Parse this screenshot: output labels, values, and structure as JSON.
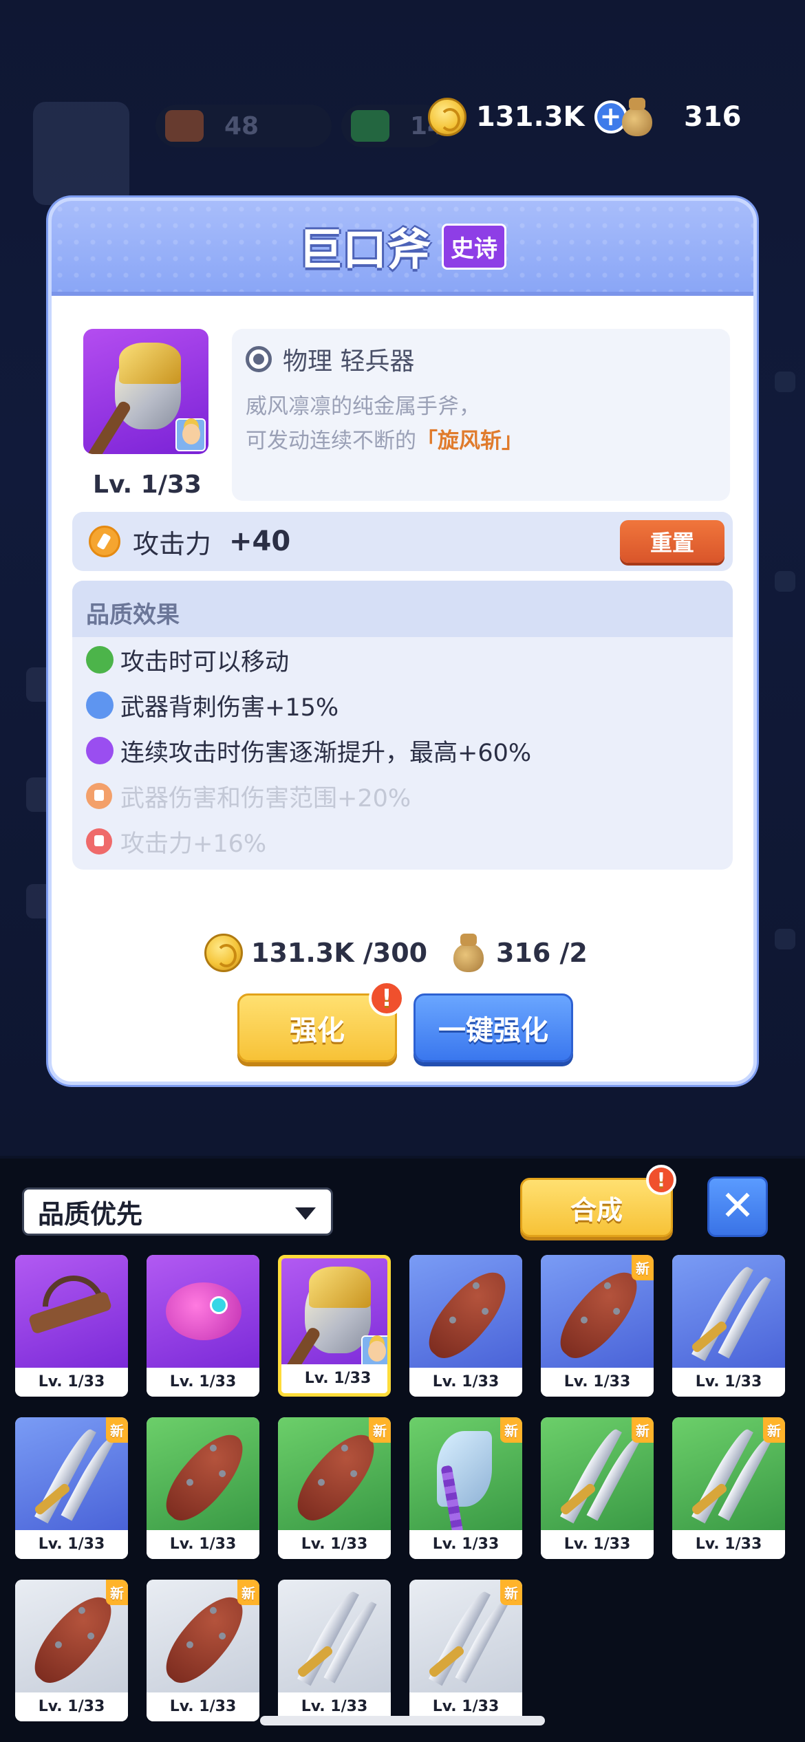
{
  "background": {
    "pill_values": [
      "48",
      "14"
    ]
  },
  "currency": {
    "coins": "131.3K",
    "bags": "316"
  },
  "modal": {
    "title": "巨口斧",
    "rarity": "史诗",
    "item_level": "Lv. 1/33",
    "weapon_type": "物理 轻兵器",
    "desc_line1": "威风凛凛的纯金属手斧，",
    "desc_line2_prefix": "可发动连续不断的",
    "desc_highlight": "「旋风斩」",
    "attack_label": "攻击力",
    "attack_value": "+40",
    "reset_label": "重置",
    "quality_title": "品质效果",
    "effects": [
      {
        "text": "攻击时可以移动",
        "color": "#4cb44a",
        "locked": false
      },
      {
        "text": "武器背刺伤害+15%",
        "color": "#5e95f0",
        "locked": false
      },
      {
        "text": "连续攻击时伤害逐渐提升，最高+60%",
        "color": "#9a4ef0",
        "locked": false
      },
      {
        "text": "武器伤害和伤害范围+20%",
        "color": "#f3a06a",
        "locked": true
      },
      {
        "text": "攻击力+16%",
        "color": "#ef6a6a",
        "locked": true
      }
    ],
    "cost_coins": "131.3K /300",
    "cost_bags": "316 /2",
    "upgrade_label": "强化",
    "one_click_label": "一键强化",
    "alert_mark": "!"
  },
  "inventory": {
    "sort_label": "品质优先",
    "merge_label": "合成",
    "close_label": "✕",
    "new_badge": "新",
    "items": [
      {
        "lv": "Lv. 1/33",
        "bg": "purple",
        "art": "crossbow",
        "is_new": false,
        "selected": false
      },
      {
        "lv": "Lv. 1/33",
        "bg": "purple",
        "art": "creature",
        "is_new": false,
        "selected": false
      },
      {
        "lv": "Lv. 1/33",
        "bg": "purple",
        "art": "axe",
        "is_new": false,
        "selected": true
      },
      {
        "lv": "Lv. 1/33",
        "bg": "blue",
        "art": "club",
        "is_new": false,
        "selected": false
      },
      {
        "lv": "Lv. 1/33",
        "bg": "blue",
        "art": "club",
        "is_new": true,
        "selected": false
      },
      {
        "lv": "Lv. 1/33",
        "bg": "blue",
        "art": "sword",
        "is_new": false,
        "selected": false
      },
      {
        "lv": "Lv. 1/33",
        "bg": "blue",
        "art": "sword",
        "is_new": true,
        "selected": false
      },
      {
        "lv": "Lv. 1/33",
        "bg": "green",
        "art": "club",
        "is_new": false,
        "selected": false
      },
      {
        "lv": "Lv. 1/33",
        "bg": "green",
        "art": "club",
        "is_new": true,
        "selected": false
      },
      {
        "lv": "Lv. 1/33",
        "bg": "green",
        "art": "bigaxe",
        "is_new": true,
        "selected": false
      },
      {
        "lv": "Lv. 1/33",
        "bg": "green",
        "art": "sword",
        "is_new": true,
        "selected": false
      },
      {
        "lv": "Lv. 1/33",
        "bg": "green",
        "art": "sword",
        "is_new": true,
        "selected": false
      },
      {
        "lv": "Lv. 1/33",
        "bg": "gray",
        "art": "club",
        "is_new": true,
        "selected": false
      },
      {
        "lv": "Lv. 1/33",
        "bg": "gray",
        "art": "club",
        "is_new": true,
        "selected": false
      },
      {
        "lv": "Lv. 1/33",
        "bg": "gray",
        "art": "sword",
        "is_new": false,
        "selected": false
      },
      {
        "lv": "Lv. 1/33",
        "bg": "gray",
        "art": "sword",
        "is_new": true,
        "selected": false
      }
    ]
  }
}
